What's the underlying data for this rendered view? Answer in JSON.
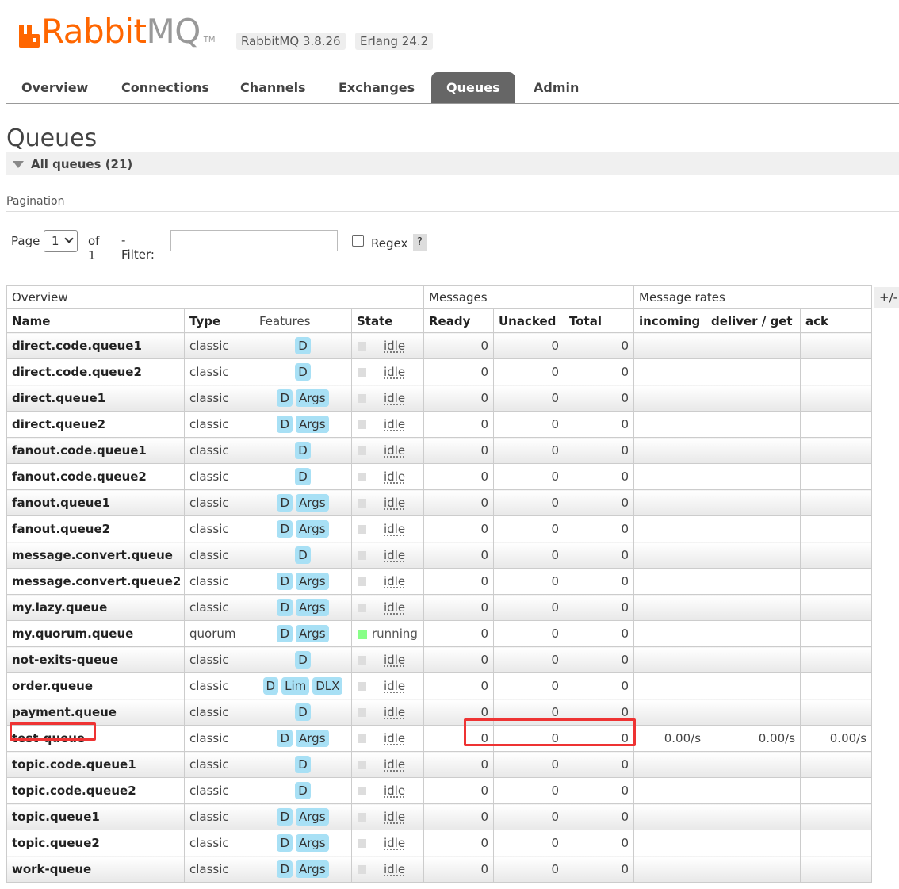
{
  "header": {
    "logo_word": "Rabbit",
    "logo_word2": "MQ",
    "logo_tm": "TM",
    "version": "RabbitMQ 3.8.26",
    "erlang": "Erlang 24.2",
    "brand_color": "#ff6600"
  },
  "tabs": [
    {
      "label": "Overview",
      "active": false
    },
    {
      "label": "Connections",
      "active": false
    },
    {
      "label": "Channels",
      "active": false
    },
    {
      "label": "Exchanges",
      "active": false
    },
    {
      "label": "Queues",
      "active": true
    },
    {
      "label": "Admin",
      "active": false
    }
  ],
  "page": {
    "title": "Queues",
    "section_label": "All queues (21)"
  },
  "pagination": {
    "label": "Pagination",
    "page_label": "Page",
    "page_value": "1",
    "of_label": "of 1",
    "filter_label": "- Filter:",
    "filter_value": "",
    "regex_label": "Regex",
    "regex_checked": false,
    "help_label": "?"
  },
  "table": {
    "plus_minus": "+/-",
    "groups": {
      "overview": "Overview",
      "messages": "Messages",
      "rates": "Message rates"
    },
    "columns": {
      "name": "Name",
      "type": "Type",
      "features": "Features",
      "state": "State",
      "ready": "Ready",
      "unacked": "Unacked",
      "total": "Total",
      "incoming": "incoming",
      "deliver_get": "deliver / get",
      "ack": "ack"
    },
    "rows": [
      {
        "name": "direct.code.queue1",
        "type": "classic",
        "features": [
          "D"
        ],
        "state": "idle",
        "ready": "0",
        "unacked": "0",
        "total": "0",
        "incoming": "",
        "deliver_get": "",
        "ack": ""
      },
      {
        "name": "direct.code.queue2",
        "type": "classic",
        "features": [
          "D"
        ],
        "state": "idle",
        "ready": "0",
        "unacked": "0",
        "total": "0",
        "incoming": "",
        "deliver_get": "",
        "ack": ""
      },
      {
        "name": "direct.queue1",
        "type": "classic",
        "features": [
          "D",
          "Args"
        ],
        "state": "idle",
        "ready": "0",
        "unacked": "0",
        "total": "0",
        "incoming": "",
        "deliver_get": "",
        "ack": ""
      },
      {
        "name": "direct.queue2",
        "type": "classic",
        "features": [
          "D",
          "Args"
        ],
        "state": "idle",
        "ready": "0",
        "unacked": "0",
        "total": "0",
        "incoming": "",
        "deliver_get": "",
        "ack": ""
      },
      {
        "name": "fanout.code.queue1",
        "type": "classic",
        "features": [
          "D"
        ],
        "state": "idle",
        "ready": "0",
        "unacked": "0",
        "total": "0",
        "incoming": "",
        "deliver_get": "",
        "ack": ""
      },
      {
        "name": "fanout.code.queue2",
        "type": "classic",
        "features": [
          "D"
        ],
        "state": "idle",
        "ready": "0",
        "unacked": "0",
        "total": "0",
        "incoming": "",
        "deliver_get": "",
        "ack": ""
      },
      {
        "name": "fanout.queue1",
        "type": "classic",
        "features": [
          "D",
          "Args"
        ],
        "state": "idle",
        "ready": "0",
        "unacked": "0",
        "total": "0",
        "incoming": "",
        "deliver_get": "",
        "ack": ""
      },
      {
        "name": "fanout.queue2",
        "type": "classic",
        "features": [
          "D",
          "Args"
        ],
        "state": "idle",
        "ready": "0",
        "unacked": "0",
        "total": "0",
        "incoming": "",
        "deliver_get": "",
        "ack": ""
      },
      {
        "name": "message.convert.queue",
        "type": "classic",
        "features": [
          "D"
        ],
        "state": "idle",
        "ready": "0",
        "unacked": "0",
        "total": "0",
        "incoming": "",
        "deliver_get": "",
        "ack": ""
      },
      {
        "name": "message.convert.queue2",
        "type": "classic",
        "features": [
          "D",
          "Args"
        ],
        "state": "idle",
        "ready": "0",
        "unacked": "0",
        "total": "0",
        "incoming": "",
        "deliver_get": "",
        "ack": ""
      },
      {
        "name": "my.lazy.queue",
        "type": "classic",
        "features": [
          "D",
          "Args"
        ],
        "state": "idle",
        "ready": "0",
        "unacked": "0",
        "total": "0",
        "incoming": "",
        "deliver_get": "",
        "ack": ""
      },
      {
        "name": "my.quorum.queue",
        "type": "quorum",
        "features": [
          "D",
          "Args"
        ],
        "state": "running",
        "ready": "0",
        "unacked": "0",
        "total": "0",
        "incoming": "",
        "deliver_get": "",
        "ack": ""
      },
      {
        "name": "not-exits-queue",
        "type": "classic",
        "features": [
          "D"
        ],
        "state": "idle",
        "ready": "0",
        "unacked": "0",
        "total": "0",
        "incoming": "",
        "deliver_get": "",
        "ack": ""
      },
      {
        "name": "order.queue",
        "type": "classic",
        "features": [
          "D",
          "Lim",
          "DLX"
        ],
        "state": "idle",
        "ready": "0",
        "unacked": "0",
        "total": "0",
        "incoming": "",
        "deliver_get": "",
        "ack": ""
      },
      {
        "name": "payment.queue",
        "type": "classic",
        "features": [
          "D"
        ],
        "state": "idle",
        "ready": "0",
        "unacked": "0",
        "total": "0",
        "incoming": "",
        "deliver_get": "",
        "ack": ""
      },
      {
        "name": "test-queue",
        "type": "classic",
        "features": [
          "D",
          "Args"
        ],
        "state": "idle",
        "ready": "0",
        "unacked": "0",
        "total": "0",
        "incoming": "0.00/s",
        "deliver_get": "0.00/s",
        "ack": "0.00/s"
      },
      {
        "name": "topic.code.queue1",
        "type": "classic",
        "features": [
          "D"
        ],
        "state": "idle",
        "ready": "0",
        "unacked": "0",
        "total": "0",
        "incoming": "",
        "deliver_get": "",
        "ack": ""
      },
      {
        "name": "topic.code.queue2",
        "type": "classic",
        "features": [
          "D"
        ],
        "state": "idle",
        "ready": "0",
        "unacked": "0",
        "total": "0",
        "incoming": "",
        "deliver_get": "",
        "ack": ""
      },
      {
        "name": "topic.queue1",
        "type": "classic",
        "features": [
          "D",
          "Args"
        ],
        "state": "idle",
        "ready": "0",
        "unacked": "0",
        "total": "0",
        "incoming": "",
        "deliver_get": "",
        "ack": ""
      },
      {
        "name": "topic.queue2",
        "type": "classic",
        "features": [
          "D",
          "Args"
        ],
        "state": "idle",
        "ready": "0",
        "unacked": "0",
        "total": "0",
        "incoming": "",
        "deliver_get": "",
        "ack": ""
      },
      {
        "name": "work-queue",
        "type": "classic",
        "features": [
          "D",
          "Args"
        ],
        "state": "idle",
        "ready": "0",
        "unacked": "0",
        "total": "0",
        "incoming": "",
        "deliver_get": "",
        "ack": ""
      }
    ]
  }
}
